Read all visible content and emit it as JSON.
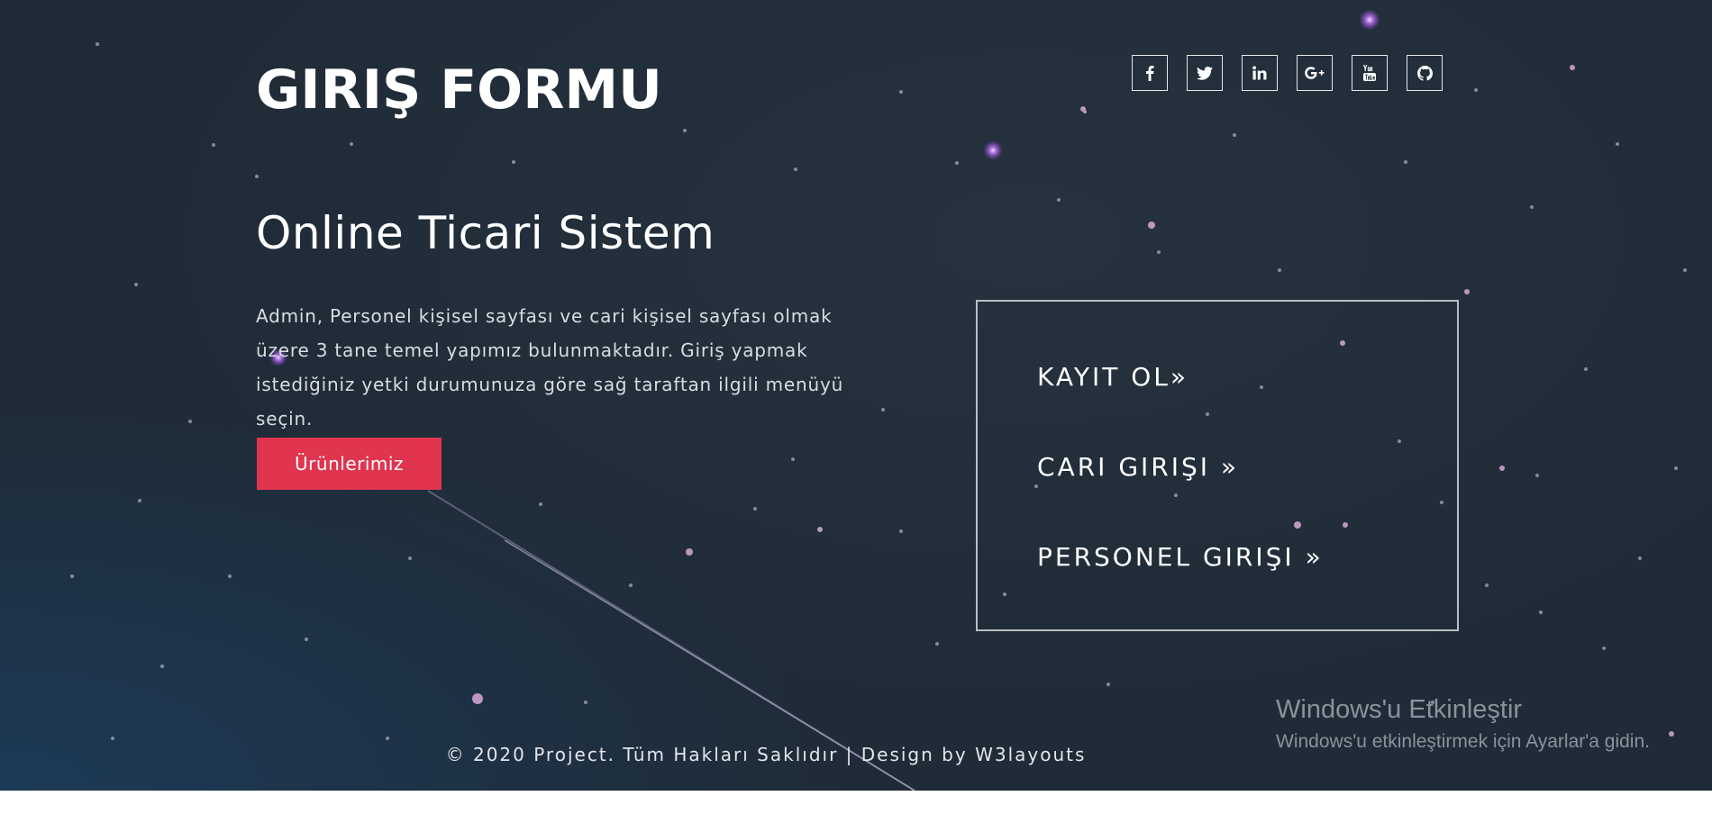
{
  "header": {
    "title": "GIRIŞ FORMU"
  },
  "social": [
    {
      "icon": "facebook-icon"
    },
    {
      "icon": "twitter-icon"
    },
    {
      "icon": "linkedin-icon"
    },
    {
      "icon": "google-plus-icon"
    },
    {
      "icon": "youtube-icon"
    },
    {
      "icon": "github-icon"
    }
  ],
  "hero": {
    "heading": "Online Ticari Sistem",
    "description": "Admin, Personel kişisel sayfası ve cari kişisel sayfası olmak üzere 3 tane temel yapımız bulunmaktadır. Giriş yapmak istediğiniz yetki durumunuza göre sağ taraftan ilgili menüyü seçin.",
    "button_label": "Ürünlerimiz"
  },
  "login_menu": {
    "items": [
      {
        "label": "KAYIT OL»"
      },
      {
        "label": "CARI GIRIŞI »"
      },
      {
        "label": "PERSONEL GIRIŞI »"
      }
    ]
  },
  "footer": {
    "copyright": "© 2020 Project. Tüm Hakları Saklıdır | Design by ",
    "design_link": "W3layouts"
  },
  "windows_watermark": {
    "title": "Windows'u Etkinleştir",
    "subtitle": "Windows'u etkinleştirmek için Ayarlar'a gidin."
  },
  "colors": {
    "background": "#1f2b37",
    "accent": "#e0344f",
    "text": "#ffffff"
  }
}
